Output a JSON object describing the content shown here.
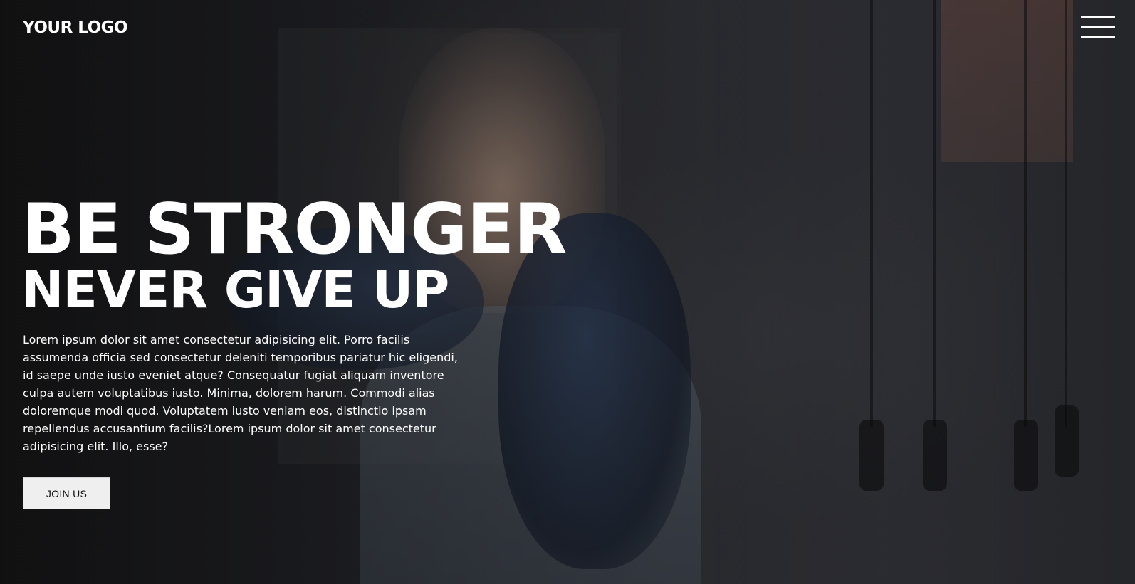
{
  "header": {
    "logo_text": "YOUR LOGO",
    "menu_icon": "hamburger-menu-icon"
  },
  "hero": {
    "headline": "BE STRONGER",
    "subheadline": "NEVER GIVE UP",
    "body": "Lorem ipsum dolor sit amet consectetur adipisicing elit. Porro facilis assumenda officia sed consectetur deleniti temporibus pariatur hic eligendi, id saepe unde iusto eveniet atque? Consequatur fugiat aliquam inventore culpa autem voluptatibus iusto. Minima, dolorem harum. Commodi alias doloremque modi quod. Voluptatem iusto veniam eos, distinctio ipsam repellendus accusantium facilis?Lorem ipsum dolor sit amet consectetur adipisicing elit. Illo, esse?",
    "cta_label": "JOIN US"
  },
  "colors": {
    "text": "#ffffff",
    "button_bg": "#efefef",
    "button_text": "#111111"
  }
}
